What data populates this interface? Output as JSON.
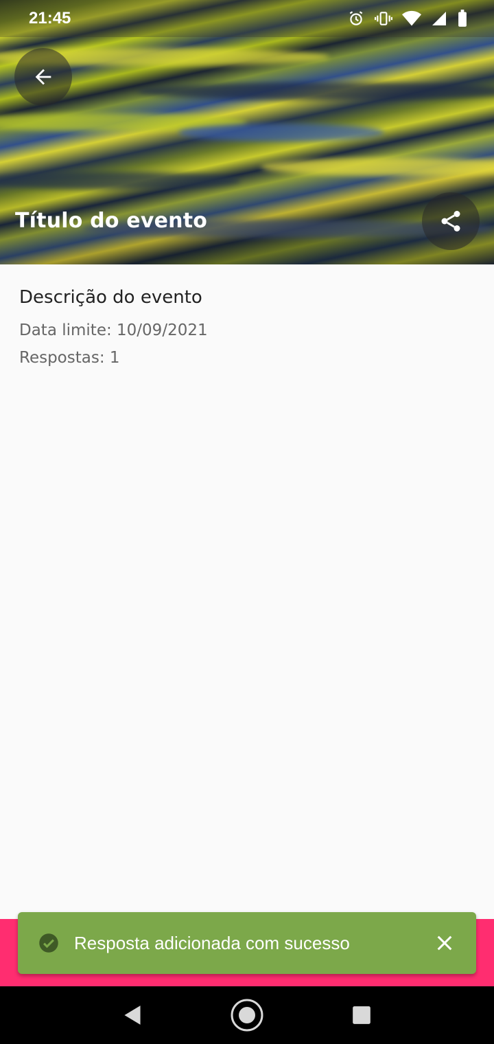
{
  "status_bar": {
    "time": "21:45",
    "icons": [
      "alarm-icon",
      "vibrate-icon",
      "wifi-icon",
      "signal-icon",
      "battery-icon"
    ]
  },
  "header": {
    "title": "Título do evento",
    "back_icon": "arrow-back-icon",
    "share_icon": "share-icon"
  },
  "event": {
    "description": "Descrição do evento",
    "deadline": "Data limite: 10/09/2021",
    "responses": "Respostas: 1"
  },
  "snackbar": {
    "message": "Resposta adicionada com sucesso",
    "icon": "check-circle-icon",
    "close_icon": "close-icon",
    "color": "#7ca84a"
  },
  "nav": {
    "items": [
      "back-nav-icon",
      "home-nav-icon",
      "recents-nav-icon"
    ]
  },
  "colors": {
    "accent_strip": "#ff2d70",
    "background": "#fafafa"
  }
}
